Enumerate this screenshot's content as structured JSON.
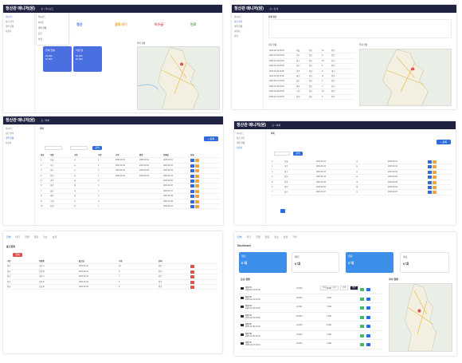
{
  "app": {
    "title": "정산관 매니저(원)"
  },
  "tiles": [
    {
      "id": "dashboard-a",
      "crumb": "홈 / 대시보드"
    },
    {
      "id": "detail-b",
      "crumb": "홈 / 상세"
    },
    {
      "id": "list-c",
      "crumb": "홈 / 목록"
    },
    {
      "id": "list-d",
      "crumb": "홈 / 목록"
    },
    {
      "id": "shipment-e"
    },
    {
      "id": "dashboard-f"
    }
  ],
  "dashboard_a": {
    "dropdown": [
      "대시보드",
      "사이트",
      "계약 현황",
      "요금",
      "설정"
    ],
    "stats": [
      {
        "label": "정산",
        "value": "0",
        "color": "#2f6bdc"
      },
      {
        "label": "결제 대기",
        "value": "0",
        "color": "#f2a33a"
      },
      {
        "label": "미수금",
        "value": "0",
        "color": "#e0524d"
      },
      {
        "label": "완료",
        "value": "0",
        "color": "#4cb56b"
      }
    ],
    "cards": [
      {
        "title": "전체 현황",
        "a": "23,000",
        "b": "10,000"
      },
      {
        "title": "이번 달",
        "a": "34,000",
        "b": "20,000"
      }
    ],
    "map_label": "위치 현황"
  },
  "detail_b": {
    "header": "상세 정보",
    "section": "이용 현황",
    "map_label": "위치 현황",
    "rows": [
      [
        "2023.01.01 09:00",
        "서울",
        "정산",
        "12",
        "완료"
      ],
      [
        "2023.01.02 09:00",
        "부산",
        "정산",
        "8",
        "완료"
      ],
      [
        "2023.01.03 09:00",
        "대구",
        "정산",
        "15",
        "대기"
      ],
      [
        "2023.01.04 09:00",
        "인천",
        "정산",
        "6",
        "완료"
      ],
      [
        "2023.01.05 09:00",
        "광주",
        "정산",
        "9",
        "대기"
      ],
      [
        "2023.01.06 09:00",
        "대전",
        "정산",
        "11",
        "완료"
      ],
      [
        "2023.01.07 09:00",
        "울산",
        "정산",
        "4",
        "완료"
      ],
      [
        "2023.01.08 09:00",
        "세종",
        "정산",
        "7",
        "대기"
      ],
      [
        "2023.01.09 09:00",
        "수원",
        "정산",
        "10",
        "완료"
      ],
      [
        "2023.01.10 09:00",
        "창원",
        "정산",
        "5",
        "완료"
      ]
    ]
  },
  "list_c": {
    "header": "목록",
    "add_button": "+ 등록",
    "search_button": "검색",
    "columns": [
      "번호",
      "이름",
      "구분",
      "수량",
      "시작",
      "종료",
      "등록일",
      "상태"
    ],
    "rows": [
      [
        "1",
        "서울",
        "가",
        "1",
        "2023.01.01",
        "2023.02.01",
        "2023.01.01"
      ],
      [
        "2",
        "부산",
        "나",
        "2",
        "2023.01.02",
        "2023.02.02",
        "2023.01.02"
      ],
      [
        "3",
        "대구",
        "다",
        "3",
        "2023.01.03",
        "2023.02.03",
        "2023.01.03"
      ],
      [
        "4",
        "인천",
        "라",
        "1",
        "2023.01.04",
        "2023.02.04",
        "2023.01.04"
      ],
      [
        "5",
        "광주",
        "마",
        "2",
        "",
        "",
        "2023.01.05"
      ],
      [
        "6",
        "대전",
        "바",
        "3",
        "",
        "",
        "2023.01.06"
      ],
      [
        "7",
        "울산",
        "사",
        "1",
        "",
        "",
        "2023.01.07"
      ],
      [
        "8",
        "세종",
        "아",
        "2",
        "",
        "",
        "2023.01.08"
      ],
      [
        "9",
        "수원",
        "자",
        "3",
        "",
        "",
        "2023.01.09"
      ],
      [
        "10",
        "창원",
        "차",
        "1",
        "",
        "",
        "2023.01.10"
      ]
    ]
  },
  "list_d": {
    "header": "목록",
    "add_button": "+ 등록",
    "search_button": "검색",
    "rows": [
      [
        "1",
        "서울",
        "2023.01.01",
        "가",
        "2023.02.01"
      ],
      [
        "2",
        "부산",
        "2023.01.02",
        "나",
        "2023.02.02"
      ],
      [
        "3",
        "대구",
        "2023.01.03",
        "다",
        "2023.02.03"
      ],
      [
        "4",
        "인천",
        "2023.01.04",
        "라",
        "2023.02.04"
      ],
      [
        "5",
        "광주",
        "2023.01.05",
        "마",
        "2023.02.05"
      ],
      [
        "6",
        "대전",
        "2023.01.06",
        "바",
        "2023.02.06"
      ],
      [
        "7",
        "울산",
        "2023.01.07",
        "사",
        "2023.02.07"
      ]
    ]
  },
  "shipment_e": {
    "tabs": [
      "전체",
      "대기",
      "진행",
      "완료",
      "취소",
      "보류"
    ],
    "section": "출고현황",
    "badge": "전체",
    "columns": [
      "구분",
      "상품명",
      "출고일",
      "수량",
      "상태"
    ],
    "rows": [
      [
        "정산",
        "상품 A",
        "2023.01.01",
        "10",
        "완료"
      ],
      [
        "정산",
        "상품 B",
        "2023.01.02",
        "5",
        "완료"
      ],
      [
        "정산",
        "상품 C",
        "2023.01.03",
        "7",
        "완료"
      ],
      [
        "정산",
        "상품 D",
        "2023.01.04",
        "3",
        "완료"
      ],
      [
        "정산",
        "상품 E",
        "2023.01.05",
        "8",
        "완료"
      ]
    ]
  },
  "dashboard_f": {
    "title": "Dashboard",
    "tabs": [
      "전체",
      "대기",
      "진행",
      "완료",
      "취소",
      "보류",
      "기타"
    ],
    "cards": [
      {
        "label": "정산",
        "value": "0 대"
      },
      {
        "label": "대기",
        "value": "0 대"
      },
      {
        "label": "완료",
        "value": "0 대"
      },
      {
        "label": "취소",
        "value": "0 대"
      }
    ],
    "list_title": "운송 현황",
    "map_title": "위치 현황",
    "filters": [
      "전체",
      "대기",
      "진행",
      "완료"
    ],
    "items": [
      {
        "name": "차량 01",
        "sub": "2023.01.01 09:00",
        "a": "12,000",
        "b": "8,000"
      },
      {
        "name": "차량 02",
        "sub": "2023.01.02 09:00",
        "a": "15,000",
        "b": "9,000"
      },
      {
        "name": "차량 03",
        "sub": "2023.01.03 09:00",
        "a": "11,000",
        "b": "7,000"
      },
      {
        "name": "차량 04",
        "sub": "2023.01.04 09:00",
        "a": "18,000",
        "b": "6,000"
      },
      {
        "name": "차량 05",
        "sub": "2023.01.05 09:00",
        "a": "14,000",
        "b": "5,000"
      },
      {
        "name": "차량 06",
        "sub": "2023.01.06 09:00",
        "a": "13,000",
        "b": "4,000"
      },
      {
        "name": "차량 07",
        "sub": "2023.01.07 09:00",
        "a": "16,000",
        "b": "3,000"
      }
    ]
  },
  "sidebar": [
    "대시보드",
    "정산 관리",
    "계약 현황",
    "사용자",
    "설정"
  ]
}
